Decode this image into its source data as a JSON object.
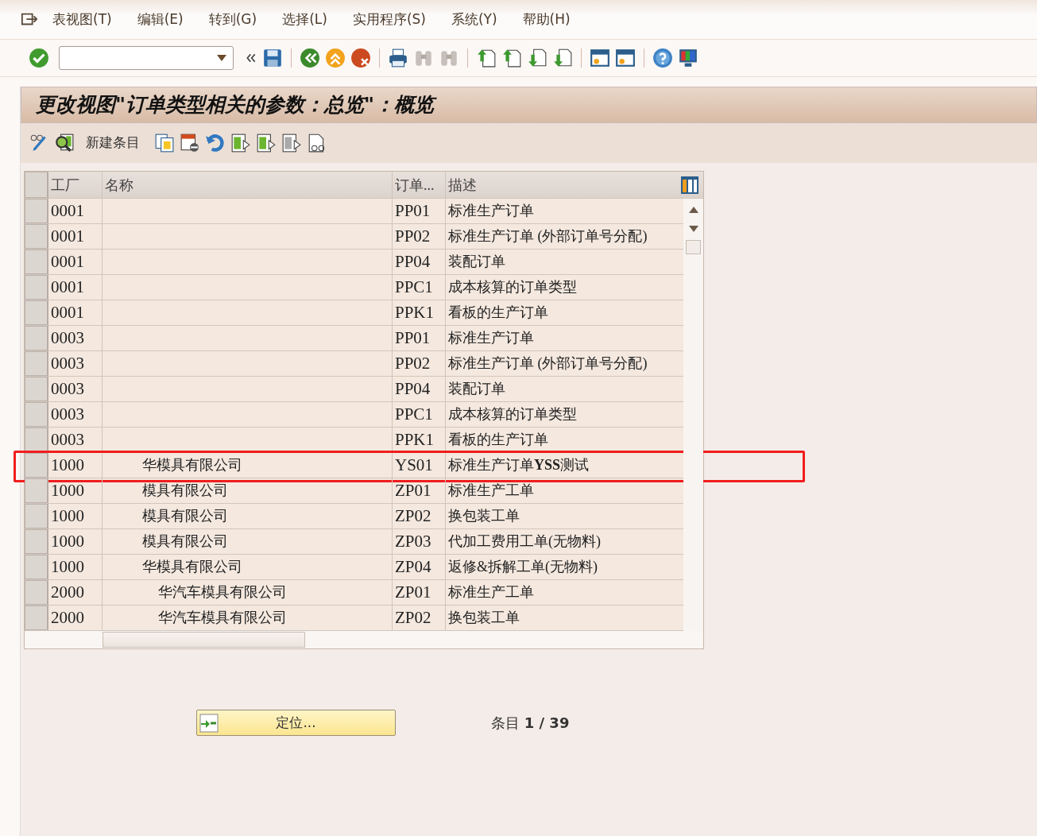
{
  "menu": [
    "表视图(T)",
    "编辑(E)",
    "转到(G)",
    "选择(L)",
    "实用程序(S)",
    "系统(Y)",
    "帮助(H)"
  ],
  "title": "更改视图\"订单类型相关的参数：总览\"：概览",
  "app_toolbar": {
    "new_entries": "新建条目"
  },
  "table": {
    "columns": [
      "工厂",
      "名称",
      "订单...",
      "描述"
    ],
    "rows": [
      {
        "plant": "0001",
        "name": "",
        "order_type": "PP01",
        "description": "标准生产订单",
        "highlighted": false
      },
      {
        "plant": "0001",
        "name": "",
        "order_type": "PP02",
        "description": "标准生产订单 (外部订单号分配)",
        "highlighted": false
      },
      {
        "plant": "0001",
        "name": "",
        "order_type": "PP04",
        "description": "装配订单",
        "highlighted": false
      },
      {
        "plant": "0001",
        "name": "",
        "order_type": "PPC1",
        "description": "成本核算的订单类型",
        "highlighted": false
      },
      {
        "plant": "0001",
        "name": "",
        "order_type": "PPK1",
        "description": "看板的生产订单",
        "highlighted": false
      },
      {
        "plant": "0003",
        "name": "",
        "order_type": "PP01",
        "description": "标准生产订单",
        "highlighted": false
      },
      {
        "plant": "0003",
        "name": "",
        "order_type": "PP02",
        "description": "标准生产订单 (外部订单号分配)",
        "highlighted": false
      },
      {
        "plant": "0003",
        "name": "",
        "order_type": "PP04",
        "description": "装配订单",
        "highlighted": false
      },
      {
        "plant": "0003",
        "name": "",
        "order_type": "PPC1",
        "description": "成本核算的订单类型",
        "highlighted": false
      },
      {
        "plant": "0003",
        "name": "",
        "order_type": "PPK1",
        "description": "看板的生产订单",
        "highlighted": false
      },
      {
        "plant": "1000",
        "name": "华模具有限公司",
        "order_type": "YS01",
        "description": "标准生产订单**YSS**测试",
        "highlighted": true
      },
      {
        "plant": "1000",
        "name": "模具有限公司",
        "order_type": "ZP01",
        "description": "标准生产工单",
        "highlighted": false
      },
      {
        "plant": "1000",
        "name": "模具有限公司",
        "order_type": "ZP02",
        "description": "换包装工单",
        "highlighted": false
      },
      {
        "plant": "1000",
        "name": "模具有限公司",
        "order_type": "ZP03",
        "description": "代加工费用工单(无物料)",
        "highlighted": false
      },
      {
        "plant": "1000",
        "name": "华模具有限公司",
        "order_type": "ZP04",
        "description": "返修&拆解工单(无物料)",
        "highlighted": false
      },
      {
        "plant": "2000",
        "name": "华汽车模具有限公司",
        "order_type": "ZP01",
        "description": "标准生产工单",
        "highlighted": false
      },
      {
        "plant": "2000",
        "name": "华汽车模具有限公司",
        "order_type": "ZP02",
        "description": "换包装工单",
        "highlighted": false
      }
    ]
  },
  "position_button": "定位...",
  "entry_count": "条目 **1 / 39**"
}
